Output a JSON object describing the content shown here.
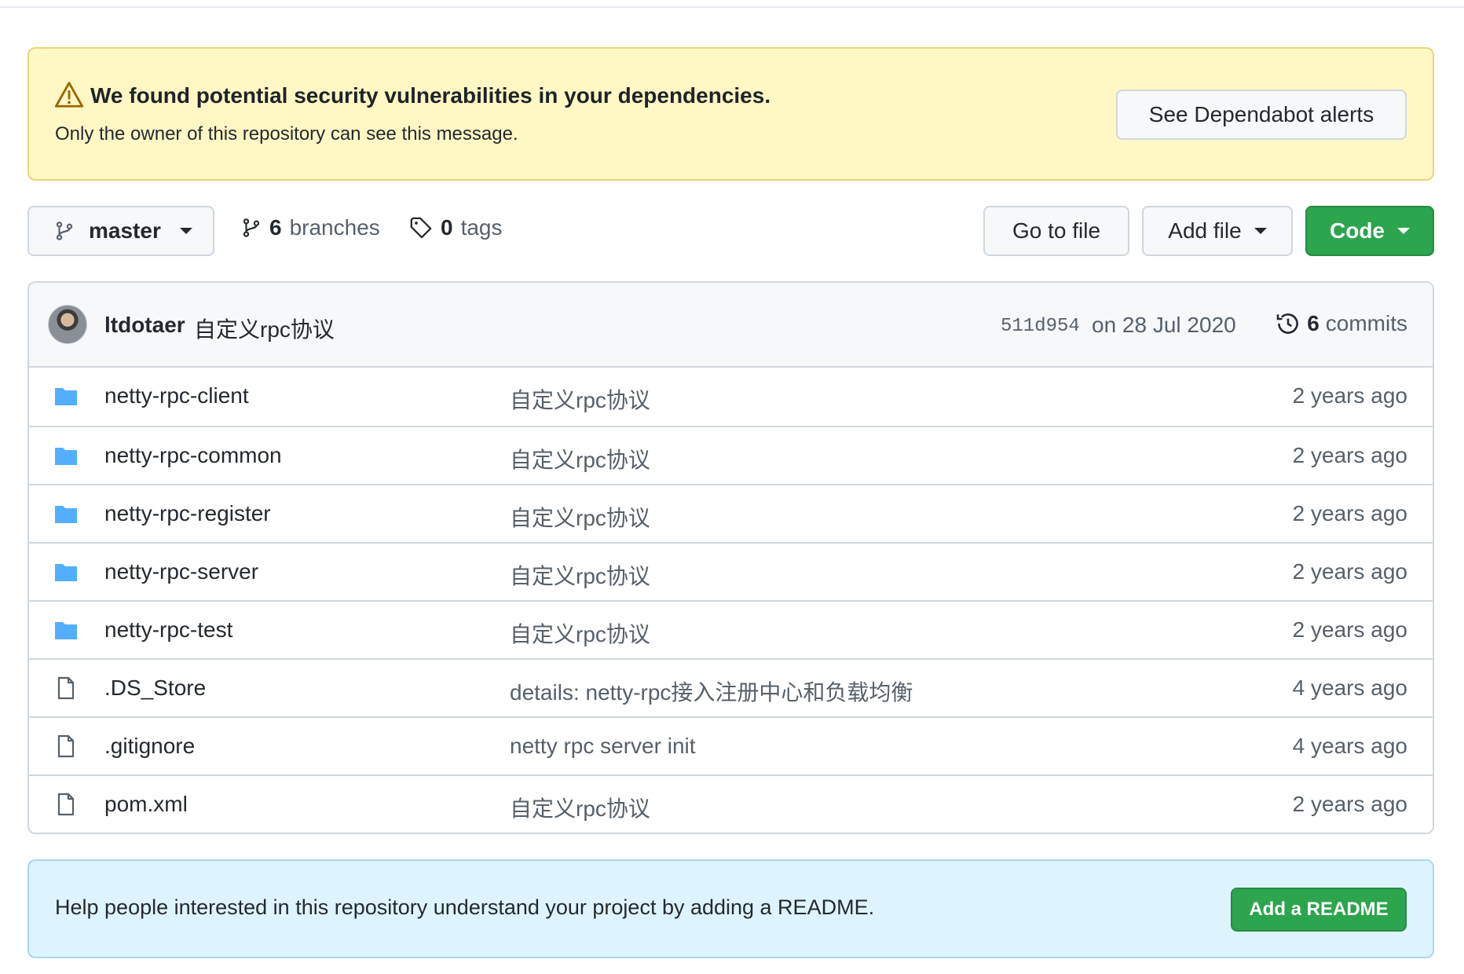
{
  "alert": {
    "title": "We found potential security vulnerabilities in your dependencies.",
    "subtitle": "Only the owner of this repository can see this message.",
    "button": "See Dependabot alerts",
    "icon": "alert-icon"
  },
  "toolbar": {
    "branch": "master",
    "branches_count": "6",
    "branches_label": "branches",
    "tags_count": "0",
    "tags_label": "tags",
    "goto_file": "Go to file",
    "add_file": "Add file",
    "code": "Code"
  },
  "commit": {
    "author": "ltdotaer",
    "message": "自定义rpc协议",
    "sha": "511d954",
    "date": "on 28 Jul 2020",
    "commits_count": "6",
    "commits_label": "commits"
  },
  "files": [
    {
      "type": "folder",
      "name": "netty-rpc-client",
      "message": "自定义rpc协议",
      "age": "2 years ago"
    },
    {
      "type": "folder",
      "name": "netty-rpc-common",
      "message": "自定义rpc协议",
      "age": "2 years ago"
    },
    {
      "type": "folder",
      "name": "netty-rpc-register",
      "message": "自定义rpc协议",
      "age": "2 years ago"
    },
    {
      "type": "folder",
      "name": "netty-rpc-server",
      "message": "自定义rpc协议",
      "age": "2 years ago"
    },
    {
      "type": "folder",
      "name": "netty-rpc-test",
      "message": "自定义rpc协议",
      "age": "2 years ago"
    },
    {
      "type": "file",
      "name": ".DS_Store",
      "message": "details: netty-rpc接入注册中心和负载均衡",
      "age": "4 years ago"
    },
    {
      "type": "file",
      "name": ".gitignore",
      "message": "netty rpc server init",
      "age": "4 years ago"
    },
    {
      "type": "file",
      "name": "pom.xml",
      "message": "自定义rpc协议",
      "age": "2 years ago"
    }
  ],
  "readme": {
    "text": "Help people interested in this repository understand your project by adding a README.",
    "button": "Add a README"
  },
  "colors": {
    "accent_green": "#2da44e",
    "folder_blue": "#54aeff",
    "alert_bg": "#fff8c5",
    "readme_bg": "#ddf4ff"
  }
}
